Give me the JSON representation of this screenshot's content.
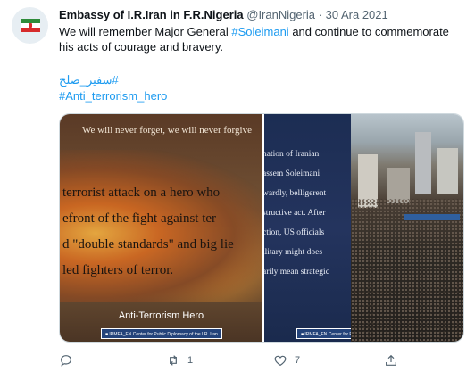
{
  "tweet": {
    "display_name": "Embassy of I.R.Iran in F.R.Nigeria",
    "handle": "@IranNigeria",
    "separator": "·",
    "date": "30 Ara 2021",
    "text_before": "We will remember Major General ",
    "hashtag_inline": "#Soleimani",
    "text_after": " and continue to commemorate his acts of courage and bravery.",
    "hashtag_1": "#سفیر_صلح",
    "hashtag_2": "#Anti_terrorism_hero"
  },
  "media": {
    "left": {
      "top_line": "We will never forget, we will never forgive",
      "lines": [
        "terrorist attack on a hero who",
        "efront of the fight against ter",
        "d \"double standards\" and big lie",
        "led fighters of terror."
      ],
      "caption": "Anti-Terrorism Hero",
      "credit": "■ IRMFA_EN  Center for Public Diplomacy of the I.R. Iran"
    },
    "middle": {
      "lines": [
        "nation of Iranian",
        "assem Soleimani",
        "wardly, belligerent",
        "structive act. After",
        "ction, US officials",
        "ilitary might does",
        "arily mean strategic"
      ],
      "credit": "■ IRMFA_EN  Center for Public Diplomacy of the I.R. Iran"
    }
  },
  "actions": {
    "reply_count": "",
    "retweet_count": "1",
    "like_count": "7"
  },
  "icons": {
    "reply": "reply-icon",
    "retweet": "retweet-icon",
    "like": "heart-icon",
    "share": "share-icon"
  },
  "colors": {
    "link": "#1d9bf0",
    "secondary_text": "#536471",
    "primary_text": "#0f1419"
  }
}
